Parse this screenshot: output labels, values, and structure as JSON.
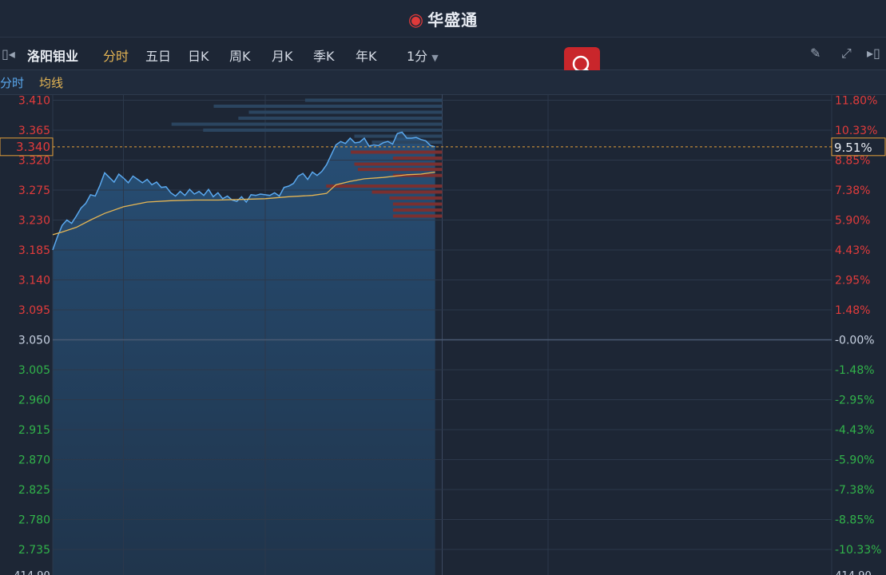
{
  "app": {
    "logo_icon": "weibo-eye-icon",
    "title": "华盛通"
  },
  "toolbar": {
    "stock_name": "洛阳钼业",
    "tabs": [
      "分时",
      "五日",
      "日K",
      "周K",
      "月K",
      "季K",
      "年K"
    ],
    "active_tab": "分时",
    "interval": "1分",
    "icons": {
      "left": "collapse-left-icon",
      "pencil": "pencil-icon",
      "expand": "fullscreen-icon",
      "right": "collapse-right-icon",
      "search": "search-icon"
    }
  },
  "subbar": {
    "series1": "分时",
    "series2": "均线"
  },
  "colors": {
    "up": "#e23b3b",
    "down": "#31b34a",
    "price_line": "#5aa8ee",
    "avg_line": "#e6b654",
    "grid": "#2c384b",
    "background": "#1d2635",
    "zero": "#4a5a73",
    "bid_bar": "#2b4560",
    "ask_bar": "#7a3030"
  },
  "chart_data": {
    "type": "line",
    "prev_close": 3.05,
    "current_price_label": "3.340",
    "current_pct_label": "9.51%",
    "y_left_ticks": [
      "3.410",
      "3.365",
      "3.320",
      "3.275",
      "3.230",
      "3.185",
      "3.140",
      "3.095",
      "3.050",
      "3.005",
      "2.960",
      "2.915",
      "2.870",
      "2.825",
      "2.780",
      "2.735"
    ],
    "y_right_ticks": [
      "11.80%",
      "10.33%",
      "8.85%",
      "7.38%",
      "5.90%",
      "4.43%",
      "2.95%",
      "1.48%",
      "-0.00%",
      "-1.48%",
      "-2.95%",
      "-4.43%",
      "-5.90%",
      "-7.38%",
      "-8.85%",
      "-10.33%"
    ],
    "bottom_clipped_left": "414.90",
    "bottom_clipped_right": "414.90",
    "ylim": [
      2.705,
      3.41
    ],
    "sessions_minutes": 330,
    "elapsed_minutes": 162,
    "price": [
      [
        0,
        3.185
      ],
      [
        2,
        3.205
      ],
      [
        4,
        3.222
      ],
      [
        6,
        3.23
      ],
      [
        8,
        3.225
      ],
      [
        10,
        3.236
      ],
      [
        12,
        3.248
      ],
      [
        14,
        3.255
      ],
      [
        16,
        3.268
      ],
      [
        18,
        3.266
      ],
      [
        20,
        3.282
      ],
      [
        22,
        3.301
      ],
      [
        24,
        3.294
      ],
      [
        26,
        3.287
      ],
      [
        28,
        3.299
      ],
      [
        30,
        3.293
      ],
      [
        32,
        3.286
      ],
      [
        34,
        3.296
      ],
      [
        36,
        3.291
      ],
      [
        38,
        3.286
      ],
      [
        40,
        3.291
      ],
      [
        42,
        3.283
      ],
      [
        44,
        3.287
      ],
      [
        46,
        3.279
      ],
      [
        48,
        3.28
      ],
      [
        50,
        3.271
      ],
      [
        52,
        3.266
      ],
      [
        54,
        3.273
      ],
      [
        56,
        3.267
      ],
      [
        58,
        3.276
      ],
      [
        60,
        3.269
      ],
      [
        62,
        3.273
      ],
      [
        64,
        3.267
      ],
      [
        66,
        3.276
      ],
      [
        68,
        3.265
      ],
      [
        70,
        3.271
      ],
      [
        72,
        3.262
      ],
      [
        74,
        3.266
      ],
      [
        76,
        3.26
      ],
      [
        78,
        3.258
      ],
      [
        80,
        3.265
      ],
      [
        82,
        3.257
      ],
      [
        84,
        3.268
      ],
      [
        86,
        3.267
      ],
      [
        88,
        3.269
      ],
      [
        90,
        3.268
      ],
      [
        92,
        3.267
      ],
      [
        94,
        3.271
      ],
      [
        96,
        3.266
      ],
      [
        98,
        3.279
      ],
      [
        100,
        3.281
      ],
      [
        102,
        3.285
      ],
      [
        104,
        3.296
      ],
      [
        106,
        3.3
      ],
      [
        108,
        3.291
      ],
      [
        110,
        3.302
      ],
      [
        112,
        3.297
      ],
      [
        114,
        3.303
      ],
      [
        116,
        3.313
      ],
      [
        118,
        3.328
      ],
      [
        120,
        3.343
      ],
      [
        122,
        3.348
      ],
      [
        124,
        3.345
      ],
      [
        126,
        3.353
      ],
      [
        128,
        3.346
      ],
      [
        130,
        3.347
      ],
      [
        132,
        3.353
      ],
      [
        134,
        3.341
      ],
      [
        136,
        3.343
      ],
      [
        138,
        3.342
      ],
      [
        140,
        3.346
      ],
      [
        142,
        3.348
      ],
      [
        144,
        3.344
      ],
      [
        146,
        3.36
      ],
      [
        148,
        3.362
      ],
      [
        150,
        3.353
      ],
      [
        152,
        3.353
      ],
      [
        154,
        3.354
      ],
      [
        156,
        3.351
      ],
      [
        158,
        3.349
      ],
      [
        160,
        3.342
      ],
      [
        162,
        3.34
      ]
    ],
    "avg": [
      [
        0,
        3.208
      ],
      [
        4,
        3.212
      ],
      [
        10,
        3.219
      ],
      [
        16,
        3.23
      ],
      [
        22,
        3.24
      ],
      [
        30,
        3.25
      ],
      [
        40,
        3.257
      ],
      [
        50,
        3.259
      ],
      [
        60,
        3.26
      ],
      [
        70,
        3.26
      ],
      [
        80,
        3.261
      ],
      [
        90,
        3.262
      ],
      [
        100,
        3.265
      ],
      [
        110,
        3.267
      ],
      [
        116,
        3.27
      ],
      [
        120,
        3.283
      ],
      [
        126,
        3.288
      ],
      [
        132,
        3.292
      ],
      [
        140,
        3.294
      ],
      [
        150,
        3.298
      ],
      [
        156,
        3.299
      ],
      [
        162,
        3.302
      ]
    ],
    "order_book": {
      "bids": [
        [
          3.41,
          0.39
        ],
        [
          3.401,
          0.65
        ],
        [
          3.392,
          0.55
        ],
        [
          3.383,
          0.58
        ],
        [
          3.374,
          0.77
        ],
        [
          3.365,
          0.68
        ],
        [
          3.356,
          0.25
        ],
        [
          3.347,
          0.2
        ]
      ],
      "asks": [
        [
          3.332,
          0.26
        ],
        [
          3.323,
          0.14
        ],
        [
          3.314,
          0.25
        ],
        [
          3.306,
          0.24
        ],
        [
          3.297,
          0.14
        ],
        [
          3.281,
          0.33
        ],
        [
          3.272,
          0.2
        ],
        [
          3.263,
          0.15
        ],
        [
          3.254,
          0.14
        ],
        [
          3.245,
          0.14
        ],
        [
          3.236,
          0.14
        ]
      ]
    }
  }
}
